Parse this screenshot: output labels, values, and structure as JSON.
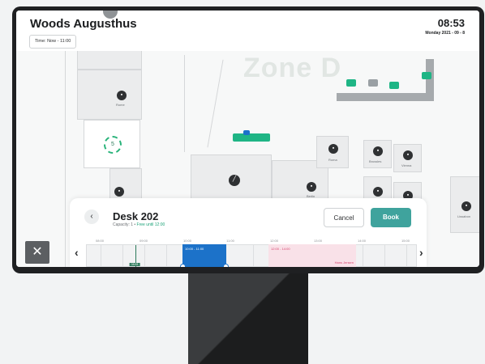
{
  "header": {
    "title": "Woods Augusthus",
    "time_filter": "Time: Now - 11:00",
    "clock": "08:53",
    "date": "Monday  2021 - 09 - 8"
  },
  "map": {
    "zone_label": "Zone D",
    "rooms": [
      {
        "name": "Rome"
      },
      {
        "name": "Roma"
      },
      {
        "name": "Brussles"
      },
      {
        "name": "Vienna"
      },
      {
        "name": "Berlin"
      },
      {
        "name": "Lissabon"
      }
    ],
    "unavailable_count": "5",
    "colors": {
      "free": "#1fb585",
      "taken": "#9aa0a4",
      "selected": "#1c72c9"
    }
  },
  "booking": {
    "back_icon": "chevron-left-icon",
    "desk_title": "Desk 202",
    "capacity": "Capacity: 1 • ",
    "availability": "Free until 12:00",
    "cancel_label": "Cancel",
    "book_label": "Book",
    "ticks": [
      "08:00",
      "09:00",
      "10:00",
      "11:00",
      "12:00",
      "13:00",
      "14:00",
      "15:00"
    ],
    "selection_times": "10:00 - 11:00",
    "booked_times": "12:00 - 14:00",
    "booked_name": "Hans Jensen",
    "now_label": "08:53",
    "colors": {
      "book": "#3fa39d",
      "selected": "#1c72c9",
      "booked": "#f9e1e8"
    }
  },
  "close_icon": "close-icon"
}
